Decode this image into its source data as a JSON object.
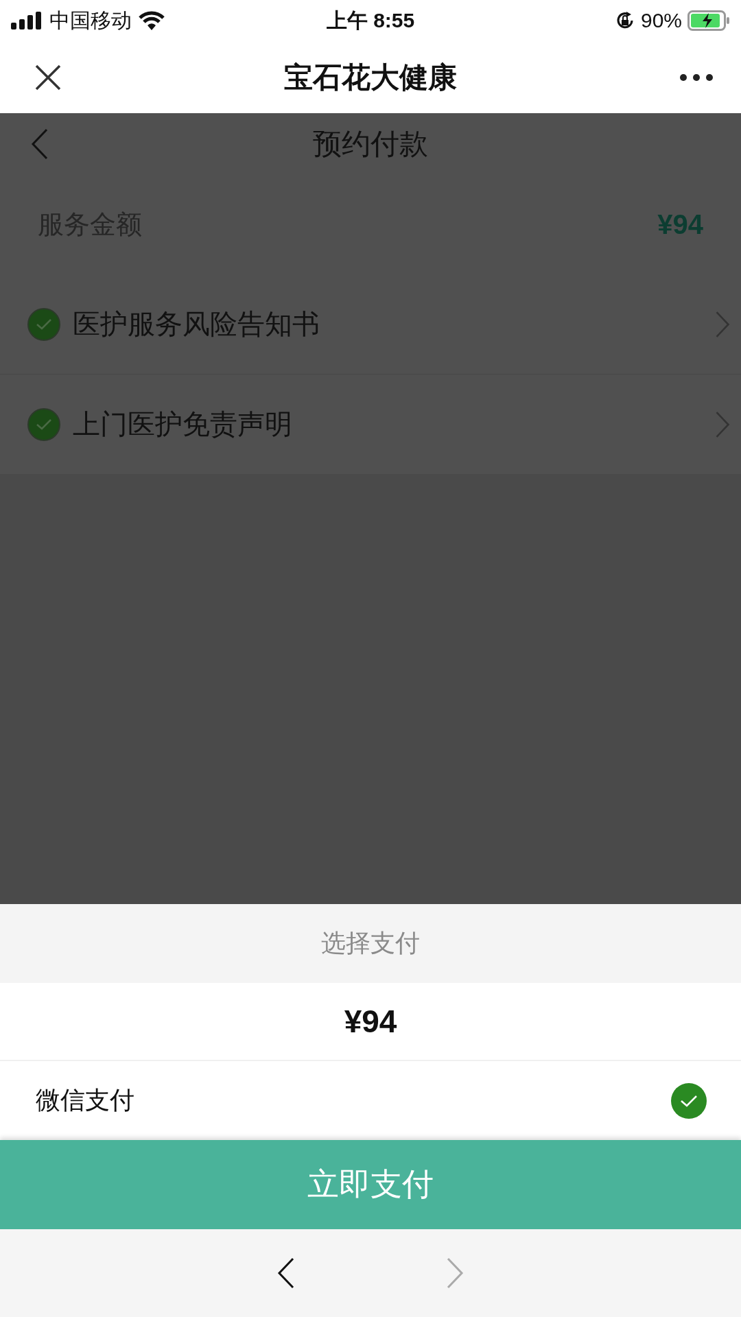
{
  "status_bar": {
    "carrier": "中国移动",
    "time": "上午 8:55",
    "battery": "90%"
  },
  "nav_bar": {
    "title": "宝石花大健康"
  },
  "page": {
    "title": "预约付款",
    "amount_label": "服务金额",
    "amount": "¥94",
    "agreements": [
      {
        "label": "医护服务风险告知书",
        "checked": true
      },
      {
        "label": "上门医护免责声明",
        "checked": true
      }
    ]
  },
  "payment_sheet": {
    "title": "选择支付",
    "amount": "¥94",
    "methods": [
      {
        "label": "微信支付",
        "selected": true
      }
    ],
    "pay_button": "立即支付"
  },
  "browser_toolbar": {
    "back_enabled": true,
    "forward_enabled": false
  }
}
